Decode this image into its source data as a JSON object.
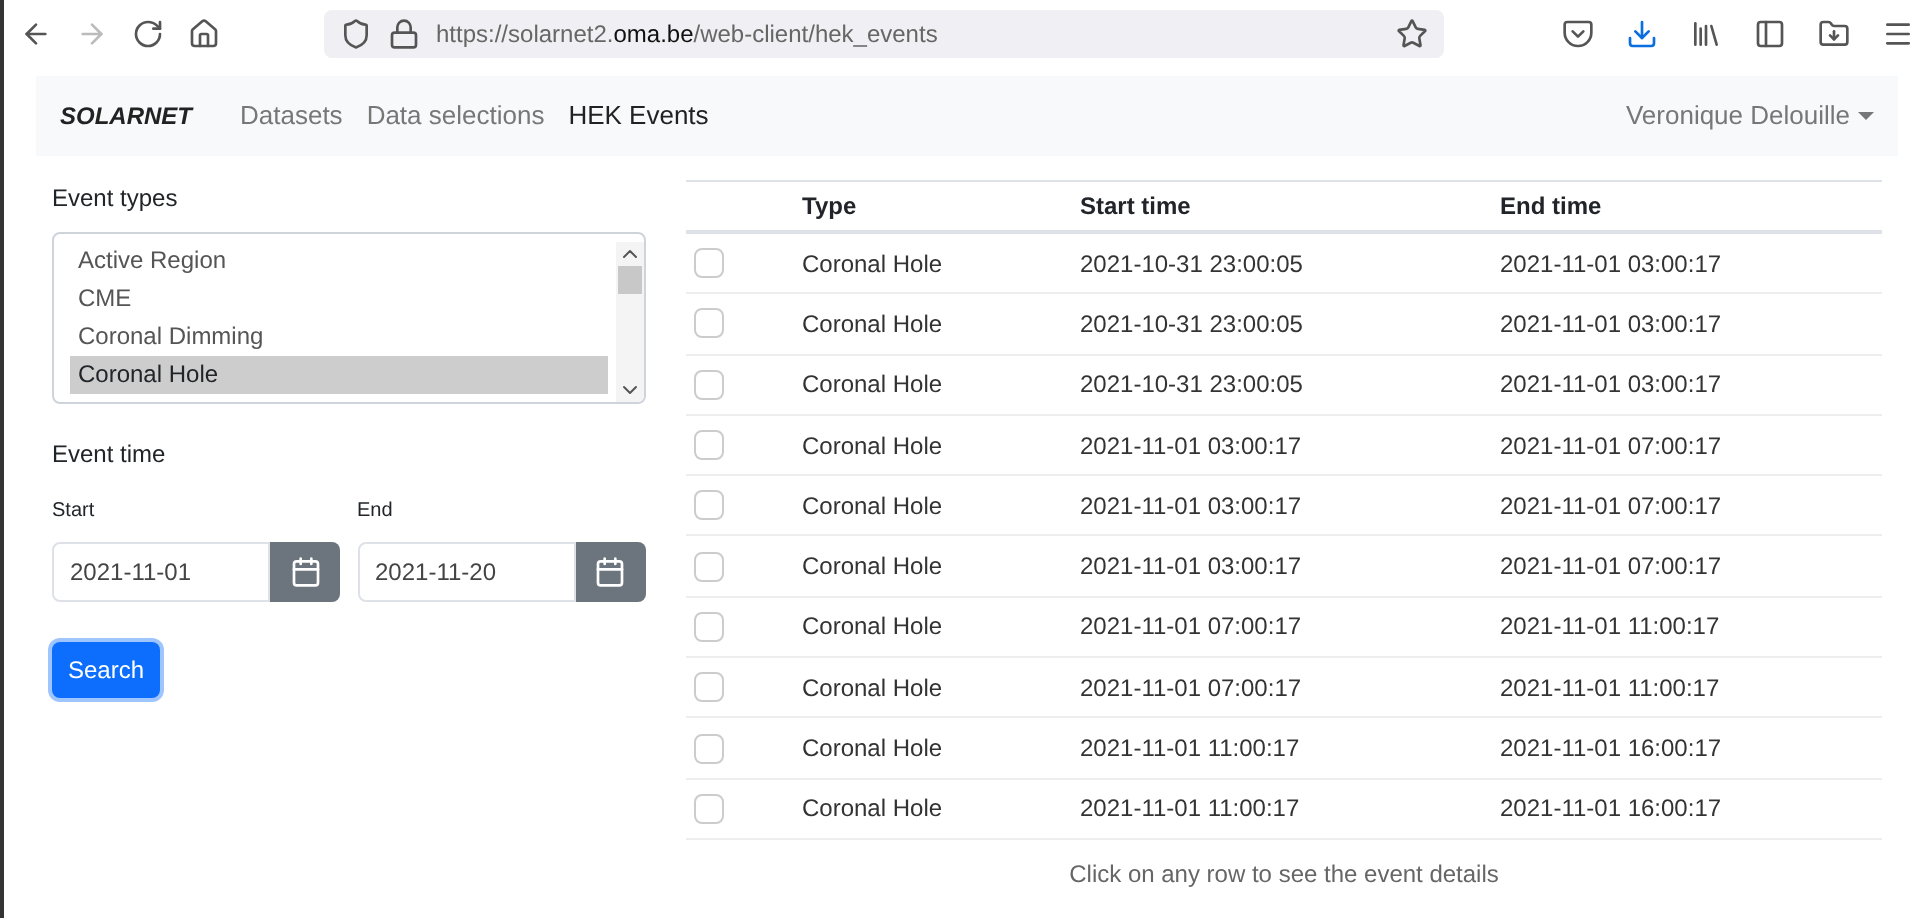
{
  "browser": {
    "url_prefix": "https://solarnet2.",
    "url_domain": "oma.be",
    "url_suffix": "/web-client/hek_events"
  },
  "navbar": {
    "brand": "SOLARNET",
    "links": [
      {
        "label": "Datasets",
        "selected": false
      },
      {
        "label": "Data selections",
        "selected": false
      },
      {
        "label": "HEK Events",
        "selected": true
      }
    ],
    "user": "Veronique Delouille"
  },
  "filters": {
    "event_types_label": "Event types",
    "event_types": [
      {
        "label": "Active Region",
        "selected": false
      },
      {
        "label": "CME",
        "selected": false
      },
      {
        "label": "Coronal Dimming",
        "selected": false
      },
      {
        "label": "Coronal Hole",
        "selected": true
      }
    ],
    "event_time_label": "Event time",
    "start_label": "Start",
    "start_value": "2021-11-01",
    "end_label": "End",
    "end_value": "2021-11-20",
    "search_button": "Search"
  },
  "table": {
    "columns": [
      "Type",
      "Start time",
      "End time"
    ],
    "rows": [
      {
        "checked": false,
        "cells": [
          "Coronal Hole",
          "2021-10-31 23:00:05",
          "2021-11-01 03:00:17"
        ]
      },
      {
        "checked": false,
        "cells": [
          "Coronal Hole",
          "2021-10-31 23:00:05",
          "2021-11-01 03:00:17"
        ]
      },
      {
        "checked": false,
        "cells": [
          "Coronal Hole",
          "2021-10-31 23:00:05",
          "2021-11-01 03:00:17"
        ]
      },
      {
        "checked": false,
        "cells": [
          "Coronal Hole",
          "2021-11-01 03:00:17",
          "2021-11-01 07:00:17"
        ]
      },
      {
        "checked": false,
        "cells": [
          "Coronal Hole",
          "2021-11-01 03:00:17",
          "2021-11-01 07:00:17"
        ]
      },
      {
        "checked": false,
        "cells": [
          "Coronal Hole",
          "2021-11-01 03:00:17",
          "2021-11-01 07:00:17"
        ]
      },
      {
        "checked": false,
        "cells": [
          "Coronal Hole",
          "2021-11-01 07:00:17",
          "2021-11-01 11:00:17"
        ]
      },
      {
        "checked": false,
        "cells": [
          "Coronal Hole",
          "2021-11-01 07:00:17",
          "2021-11-01 11:00:17"
        ]
      },
      {
        "checked": false,
        "cells": [
          "Coronal Hole",
          "2021-11-01 11:00:17",
          "2021-11-01 16:00:17"
        ]
      },
      {
        "checked": false,
        "cells": [
          "Coronal Hole",
          "2021-11-01 11:00:17",
          "2021-11-01 16:00:17"
        ]
      }
    ],
    "hint": "Click on any row to see the event details"
  }
}
